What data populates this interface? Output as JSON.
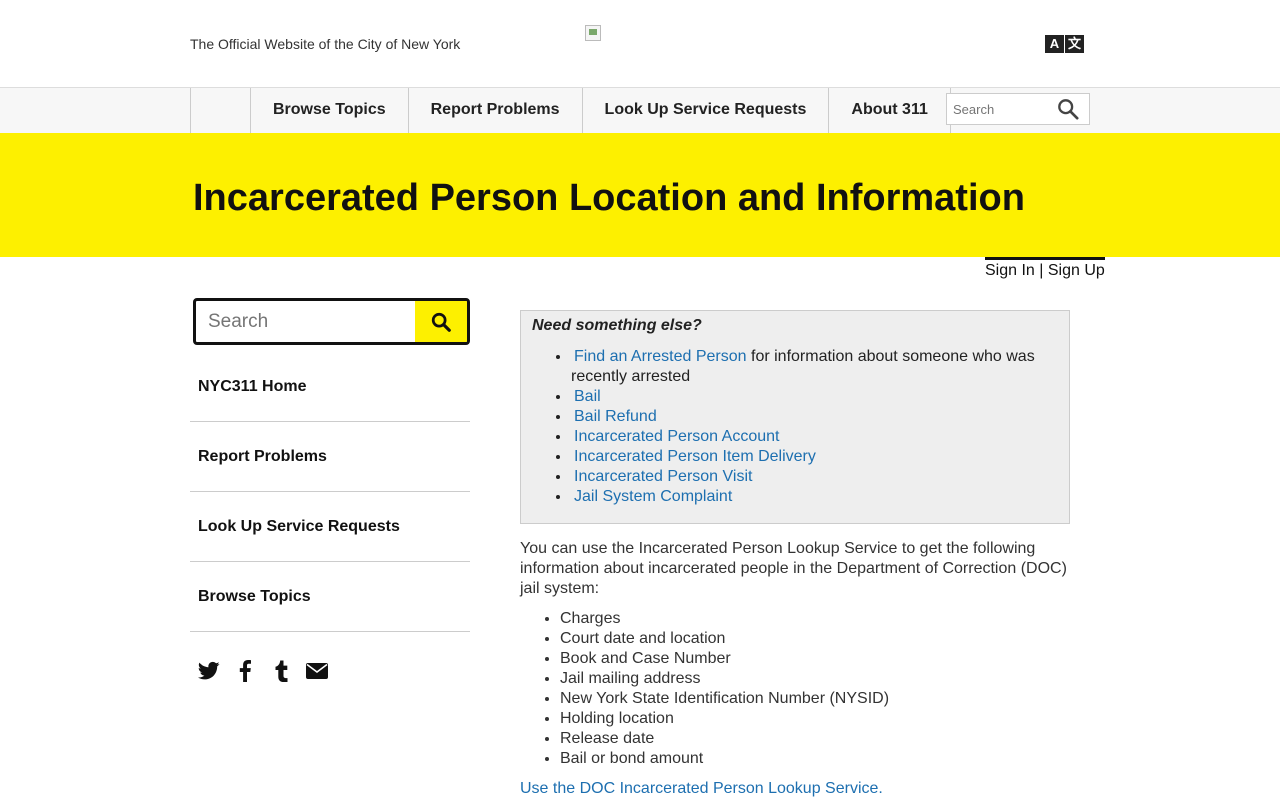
{
  "header": {
    "official_text": "The Official Website of the City of New York",
    "translate_glyphs": [
      "A",
      "文"
    ]
  },
  "nav": {
    "items": [
      "Browse Topics",
      "Report Problems",
      "Look Up Service Requests",
      "About 311"
    ],
    "search_placeholder": "Search"
  },
  "banner": {
    "title": "Incarcerated Person Location and Information"
  },
  "account": {
    "sign_in": "Sign In",
    "separator": " | ",
    "sign_up": "Sign Up"
  },
  "sidebar": {
    "search_placeholder": "Search",
    "items": [
      "NYC311 Home",
      "Report Problems",
      "Look Up Service Requests",
      "Browse Topics"
    ],
    "social_icons": [
      "twitter-icon",
      "facebook-icon",
      "tumblr-icon",
      "email-icon"
    ]
  },
  "related": {
    "title": "Need something else?",
    "first_link": "Find an Arrested Person",
    "first_suffix": " for information about someone who was recently arrested",
    "links": [
      "Bail",
      "Bail Refund",
      "Incarcerated Person Account",
      "Incarcerated Person Item Delivery",
      "Incarcerated Person Visit",
      "Jail System Complaint"
    ]
  },
  "main": {
    "intro": "You can use the Incarcerated Person Lookup Service to get the following information about incarcerated people in the Department of Correction (DOC) jail system:",
    "facts": [
      "Charges",
      "Court date and location",
      "Book and Case Number",
      "Jail mailing address",
      "New York State Identification Number (NYSID)",
      "Holding location",
      "Release date",
      "Bail or bond amount"
    ],
    "lookup_link": "Use the DOC Incarcerated Person Lookup Service."
  },
  "colors": {
    "banner": "#fdf000",
    "link": "#1d6fb0"
  }
}
